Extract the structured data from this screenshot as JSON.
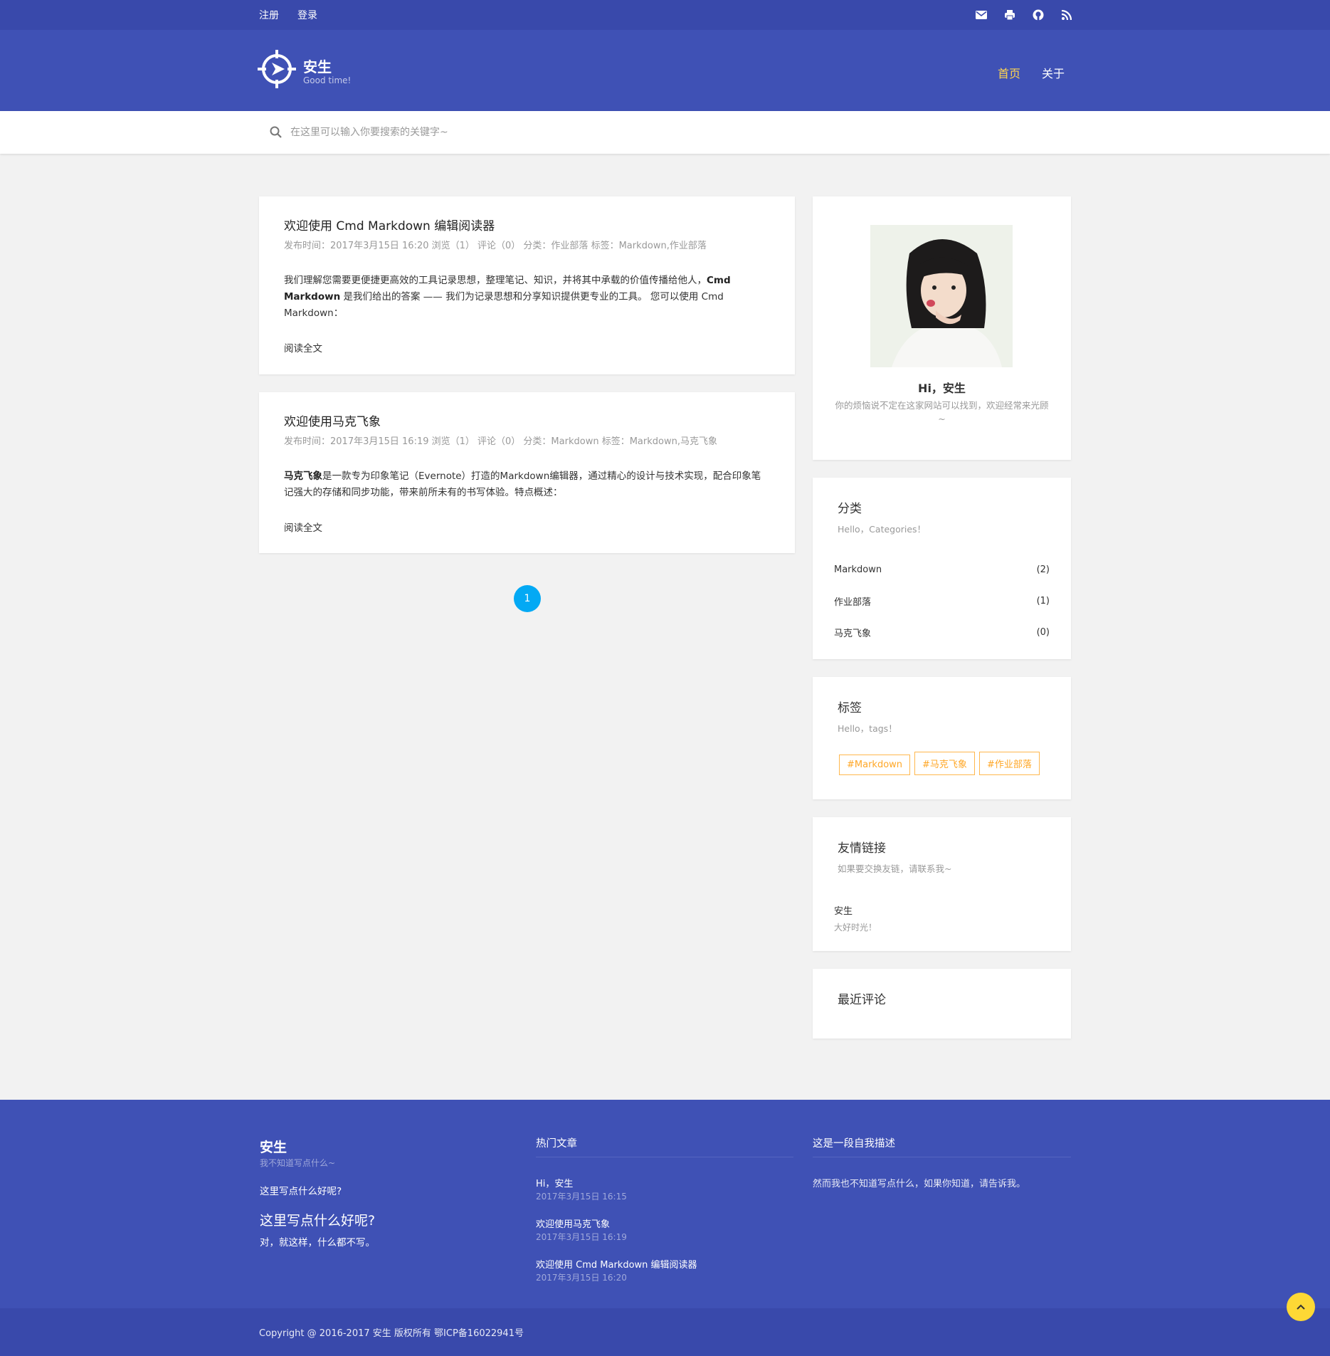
{
  "topbar": {
    "register": "注册",
    "login": "登录",
    "icons": [
      "mail-icon",
      "printer-icon",
      "github-icon",
      "rss-icon"
    ]
  },
  "header": {
    "title": "安生",
    "subtitle": "Good time!",
    "nav": [
      {
        "label": "首页",
        "active": true
      },
      {
        "label": "关于",
        "active": false
      }
    ]
  },
  "search": {
    "placeholder": "在这里可以输入你要搜索的关键字~"
  },
  "posts": [
    {
      "title": "欢迎使用 Cmd Markdown 编辑阅读器",
      "meta": "发布时间：2017年3月15日 16:20 浏览（1） 评论（0） 分类：作业部落 标签：Markdown,作业部落",
      "body_pre": "我们理解您需要更便捷更高效的工具记录思想，整理笔记、知识，并将其中承载的价值传播给他人，",
      "body_bold": "Cmd Markdown",
      "body_post": " 是我们给出的答案 —— 我们为记录思想和分享知识提供更专业的工具。 您可以使用 Cmd Markdown：",
      "read_more": "阅读全文"
    },
    {
      "title": "欢迎使用马克飞象",
      "meta": "发布时间：2017年3月15日 16:19 浏览（1） 评论（0） 分类：Markdown 标签：Markdown,马克飞象",
      "body_bold": "马克飞象",
      "body_post": "是一款专为印象笔记（Evernote）打造的Markdown编辑器，通过精心的设计与技术实现，配合印象笔记强大的存储和同步功能，带来前所未有的书写体验。特点概述：",
      "read_more": "阅读全文"
    }
  ],
  "pagination": {
    "current": "1"
  },
  "profile": {
    "greeting": "Hi，安生",
    "description": "你的烦恼说不定在这家网站可以找到，欢迎经常来光顾~"
  },
  "categories": {
    "title": "分类",
    "subtitle": "Hello，Categories！",
    "items": [
      {
        "name": "Markdown",
        "count": "(2)"
      },
      {
        "name": "作业部落",
        "count": "(1)"
      },
      {
        "name": "马克飞象",
        "count": "(0)"
      }
    ]
  },
  "tags": {
    "title": "标签",
    "subtitle": "Hello，tags！",
    "items": [
      "#Markdown",
      "#马克飞象",
      "#作业部落"
    ]
  },
  "links": {
    "title": "友情链接",
    "subtitle": "如果要交换友链，请联系我~",
    "items": [
      {
        "name": "安生",
        "desc": "大好时光！"
      }
    ]
  },
  "recent_comments": {
    "title": "最近评论"
  },
  "footer": {
    "brand": "安生",
    "brand_sub": "我不知道写点什么~",
    "line1": "这里写点什么好呢?",
    "heading": "这里写点什么好呢?",
    "line2": "对，就这样，什么都不写。",
    "hot_title": "热门文章",
    "hot_posts": [
      {
        "title": "Hi，安生",
        "date": "2017年3月15日 16:15"
      },
      {
        "title": "欢迎使用马克飞象",
        "date": "2017年3月15日 16:19"
      },
      {
        "title": "欢迎使用 Cmd Markdown 编辑阅读器",
        "date": "2017年3月15日 16:20"
      }
    ],
    "about_title": "这是一段自我描述",
    "about_text": "然而我也不知道写点什么，如果你知道，请告诉我。"
  },
  "copyright": "Copyright @ 2016-2017 安生 版权所有 鄂ICP备16022941号",
  "colors": {
    "primary": "#3f51b5",
    "primary_dark": "#3949ab",
    "accent": "#ffd54f",
    "pager": "#03a9f4",
    "tag": "#ffa726"
  }
}
